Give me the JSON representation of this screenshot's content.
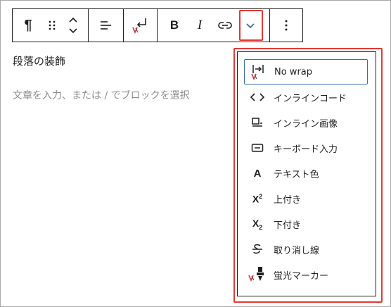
{
  "editor": {
    "block_title": "段落の装飾",
    "placeholder": "文章を入力、または / でブロックを選択"
  },
  "toolbar": {
    "paragraph_icon": "¶",
    "drag_icon": "drag-handle-icon",
    "move_icon": "chevron-up-down-icon",
    "align_icon": "align-left-icon",
    "wrap_icon": "return-arrow-icon",
    "bold_label": "B",
    "italic_label": "I",
    "link_icon": "link-icon",
    "more_formats_icon": "chevron-down-icon",
    "options_icon": "vertical-ellipsis-icon"
  },
  "format_menu": {
    "items": [
      {
        "label": "No wrap",
        "icon": "no-wrap-icon"
      },
      {
        "label": "インラインコード",
        "icon": "code-icon"
      },
      {
        "label": "インライン画像",
        "icon": "inline-image-icon"
      },
      {
        "label": "キーボード入力",
        "icon": "keyboard-icon"
      },
      {
        "label": "テキスト色",
        "icon": "text-color-icon",
        "glyph": "A"
      },
      {
        "label": "上付き",
        "icon": "superscript-icon",
        "glyph": "X",
        "script": "2"
      },
      {
        "label": "下付き",
        "icon": "subscript-icon",
        "glyph": "X",
        "script": "2"
      },
      {
        "label": "取り消し線",
        "icon": "strikethrough-icon"
      },
      {
        "label": "蛍光マーカー",
        "icon": "highlighter-icon"
      }
    ]
  },
  "colors": {
    "highlight_border": "#e53935",
    "focus_border": "#3b6ea5",
    "plugin_badge": "#d32f2f",
    "placeholder_text": "#8c8c8c",
    "ink": "#1e1e1e"
  }
}
